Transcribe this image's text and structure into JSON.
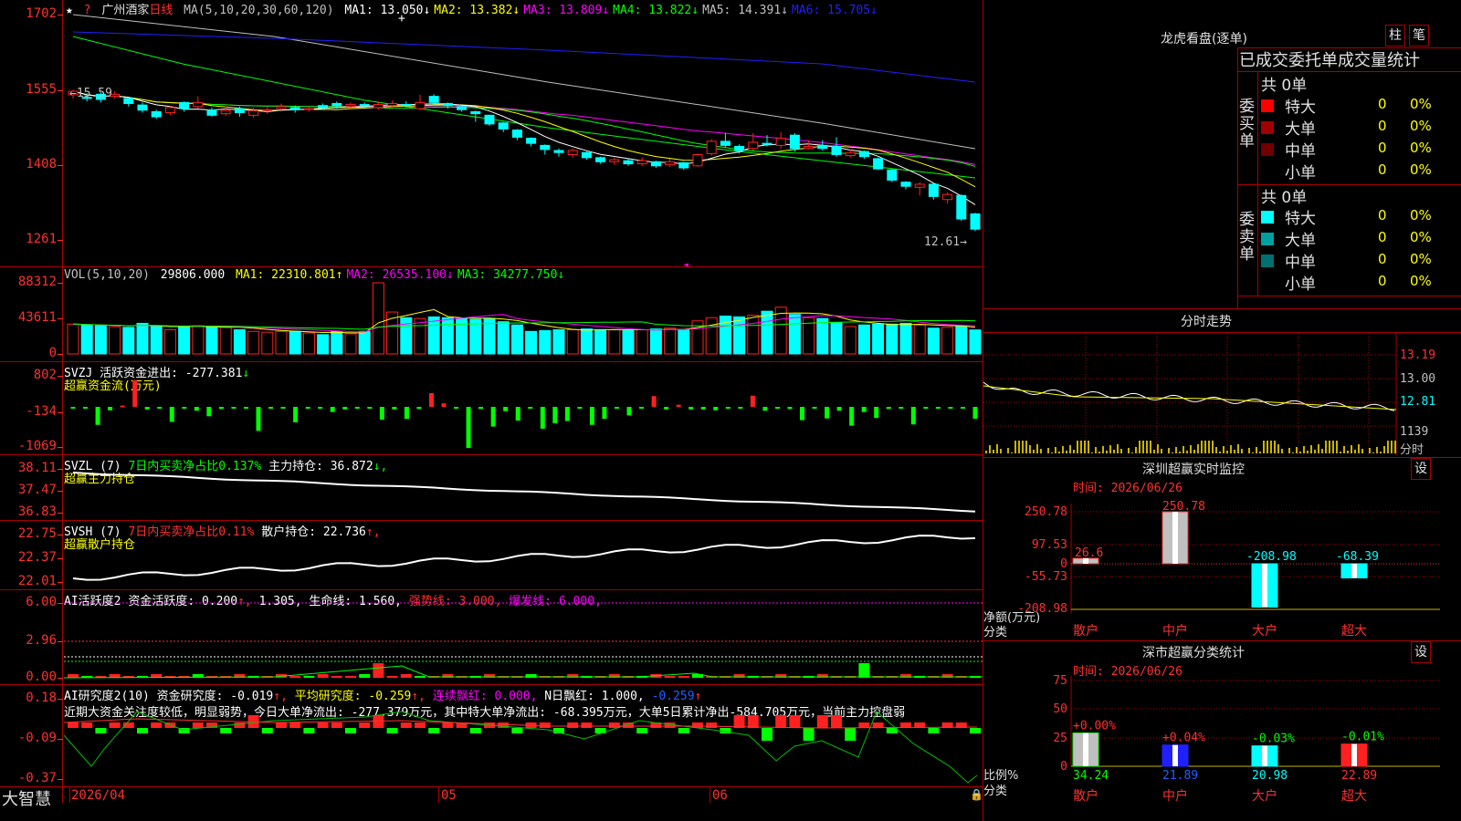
{
  "app": {
    "name": "大智慧"
  },
  "stock": {
    "name": "广州酒家",
    "period": "日线"
  },
  "colors": {
    "up": "#ff2020",
    "down": "#00ffff",
    "grid": "#a80000",
    "ma1": "#ffff00",
    "ma2": "#ff00ff",
    "ma3": "#00ff00",
    "ma4": "#ffffff",
    "ma5": "#c0c0c0",
    "ma6": "#2020ff"
  },
  "main_chart": {
    "ma_header": "MA(5,10,20,30,60,120)",
    "ma": [
      {
        "label": "MA1: 13.050",
        "arrow": "↓",
        "color": "#ffffff"
      },
      {
        "label": "MA2: 13.382",
        "arrow": "↓",
        "color": "#ffff00"
      },
      {
        "label": "MA3: 13.809",
        "arrow": "↓",
        "color": "#ff00ff"
      },
      {
        "label": "MA4: 13.822",
        "arrow": "↓",
        "color": "#00ff00"
      },
      {
        "label": "MA5: 14.391",
        "arrow": "↓",
        "color": "#c0c0c0"
      },
      {
        "label": "MA6: 15.705",
        "arrow": "↓",
        "color": "#2020ff"
      }
    ],
    "y_ticks": [
      "1702",
      "1555",
      "1408",
      "1261"
    ],
    "high_label": "←15.59",
    "last_label": "12.61→"
  },
  "vol_panel": {
    "header": "VOL(5,10,20)",
    "value": "29806.000",
    "ma": [
      {
        "label": "MA1: 22310.801",
        "arrow": "↑",
        "color": "#ffff00"
      },
      {
        "label": "MA2: 26535.100",
        "arrow": "↓",
        "color": "#ff00ff"
      },
      {
        "label": "MA3: 34277.750",
        "arrow": "↓",
        "color": "#00ff00"
      }
    ],
    "y_ticks": [
      "88312",
      "43611",
      "0"
    ]
  },
  "svzj_panel": {
    "line1": "SVZJ  活跃资金进出: -277.381",
    "line1_arrow": "↓",
    "line2": "超赢资金流(万元)",
    "y_ticks": [
      "802",
      "-134",
      "-1069"
    ]
  },
  "svzl_panel": {
    "name": "SVZL (7)",
    "pct": "7日内买卖净占比0.137%",
    "hold": "主力持仓: 36.872",
    "arrow": "↓,",
    "line2": "超赢主力持仓",
    "y_ticks": [
      "38.11",
      "37.47",
      "36.83"
    ]
  },
  "svsh_panel": {
    "name": "SVSH (7)",
    "pct": "7日内买卖净占比0.11%",
    "hold": "散户持仓: 22.736",
    "arrow": "↑,",
    "line2": "超赢散户持仓",
    "y_ticks": [
      "22.75",
      "22.37",
      "22.01"
    ]
  },
  "ai_active_panel": {
    "name": "AI活跃度2",
    "a": "资金活跃度: 0.200",
    "b": "1.305,",
    "c": "生命线: 1.560,",
    "d": "强势线: 3.000,",
    "e": "爆发线: 6.000,",
    "y_ticks": [
      "6.00",
      "2.96",
      "0.00"
    ]
  },
  "ai_research_panel": {
    "name": "AI研究度2(10)",
    "a": "资金研究度: -0.019",
    "b": "平均研究度: -0.259",
    "c": "连续飘红: 0.000,",
    "d": "N日飘红: 1.000,",
    "e": "-0.259",
    "comment": "近期大资金关注度较低，明显弱势，今日大单净流出: -277.379万元，其中特大单净流出: -68.395万元，大单5日累计净出-584.705万元，当前主力控盘弱",
    "y_ticks": [
      "0.18",
      "-0.09",
      "-0.37"
    ]
  },
  "x_axis": {
    "labels": [
      "2026/04",
      "05",
      "06"
    ]
  },
  "lhb": {
    "title": "龙虎看盘(逐单)",
    "btn1": "柱",
    "btn2": "笔",
    "header": "已成交委托单成交量统计",
    "buy_label": "委买单",
    "sell_label": "委卖单",
    "buy_total": "共 0单",
    "sell_total": "共 0单",
    "buy_rows": [
      {
        "name": "特大",
        "count": "0",
        "pct": "0%",
        "color": "#ff0000"
      },
      {
        "name": "大单",
        "count": "0",
        "pct": "0%",
        "color": "#a00000"
      },
      {
        "name": "中单",
        "count": "0",
        "pct": "0%",
        "color": "#700000"
      },
      {
        "name": "小单",
        "count": "0",
        "pct": "0%",
        "color": "#000000"
      }
    ],
    "sell_rows": [
      {
        "name": "特大",
        "count": "0",
        "pct": "0%",
        "color": "#00ffff"
      },
      {
        "name": "大单",
        "count": "0",
        "pct": "0%",
        "color": "#00a0a0"
      },
      {
        "name": "中单",
        "count": "0",
        "pct": "0%",
        "color": "#007070"
      },
      {
        "name": "小单",
        "count": "0",
        "pct": "0%",
        "color": "#000000"
      }
    ]
  },
  "intraday": {
    "title": "分时走势",
    "prices": [
      "13.19",
      "13.00",
      "12.81"
    ],
    "volume": "1139",
    "vol_unit": "分时"
  },
  "monitor": {
    "title": "深圳超赢实时监控",
    "settings": "设",
    "time": "时间: 2026/06/26",
    "y_ticks": [
      "250.78",
      "97.53",
      "0",
      "-55.73",
      "-208.98"
    ],
    "y_label1": "净额(万元)",
    "y_label2": "分类",
    "categories": [
      "散户",
      "中户",
      "大户",
      "超大"
    ],
    "values": [
      26.6,
      250.78,
      -208.98,
      -68.39
    ],
    "value_labels": [
      "26.6",
      "250.78",
      "-208.98",
      "-68.39"
    ]
  },
  "classify": {
    "title": "深市超赢分类统计",
    "settings": "设",
    "time": "时间: 2026/06/26",
    "y_ticks": [
      "75",
      "50",
      "25",
      "0"
    ],
    "y_label1": "比例%",
    "y_label2": "分类",
    "categories": [
      "散户",
      "中户",
      "大户",
      "超大"
    ],
    "changes": [
      "+0.00%",
      "+0.04%",
      "-0.03%",
      "-0.01%"
    ],
    "values": [
      34.24,
      21.89,
      20.98,
      22.89
    ],
    "value_labels": [
      "34.24",
      "21.89",
      "20.98",
      "22.89"
    ]
  },
  "chart_data": [
    {
      "type": "candlestick",
      "title": "广州酒家 日线",
      "note": "K-line values estimated from price axis (1261–1702 scale labels)",
      "ylim": [
        12.4,
        17.2
      ],
      "candles": [
        [
          15.45,
          15.52,
          15.55,
          15.38
        ],
        [
          15.4,
          15.38,
          15.48,
          15.32
        ],
        [
          15.46,
          15.36,
          15.5,
          15.3
        ],
        [
          15.42,
          15.46,
          15.52,
          15.38
        ],
        [
          15.38,
          15.28,
          15.4,
          15.22
        ],
        [
          15.25,
          15.15,
          15.3,
          15.1
        ],
        [
          15.12,
          15.02,
          15.16,
          14.98
        ],
        [
          15.1,
          15.2,
          15.24,
          15.05
        ],
        [
          15.3,
          15.18,
          15.32,
          15.12
        ],
        [
          15.22,
          15.3,
          15.42,
          15.18
        ],
        [
          15.15,
          15.05,
          15.2,
          15.02
        ],
        [
          15.08,
          15.14,
          15.22,
          15.04
        ],
        [
          15.18,
          15.1,
          15.22,
          15.02
        ],
        [
          15.05,
          15.14,
          15.2,
          15.0
        ],
        [
          15.14,
          15.16,
          15.22,
          15.08
        ],
        [
          15.18,
          15.22,
          15.28,
          15.12
        ],
        [
          15.2,
          15.16,
          15.24,
          15.1
        ],
        [
          15.16,
          15.18,
          15.22,
          15.12
        ],
        [
          15.24,
          15.2,
          15.28,
          15.16
        ],
        [
          15.28,
          15.24,
          15.32,
          15.18
        ],
        [
          15.22,
          15.26,
          15.3,
          15.18
        ],
        [
          15.26,
          15.24,
          15.3,
          15.2
        ],
        [
          15.2,
          15.26,
          15.32,
          15.16
        ],
        [
          15.24,
          15.28,
          15.34,
          15.2
        ],
        [
          15.26,
          15.24,
          15.32,
          15.2
        ],
        [
          15.18,
          15.3,
          15.45,
          15.14
        ],
        [
          15.42,
          15.3,
          15.46,
          15.26
        ],
        [
          15.28,
          15.24,
          15.3,
          15.18
        ],
        [
          15.22,
          15.16,
          15.24,
          15.12
        ],
        [
          15.12,
          15.08,
          15.14,
          14.92
        ],
        [
          15.05,
          14.88,
          15.06,
          14.84
        ],
        [
          14.9,
          14.78,
          14.92,
          14.72
        ],
        [
          14.76,
          14.62,
          14.78,
          14.56
        ],
        [
          14.6,
          14.5,
          14.62,
          14.44
        ],
        [
          14.46,
          14.38,
          14.48,
          14.28
        ],
        [
          14.36,
          14.32,
          14.4,
          14.24
        ],
        [
          14.28,
          14.36,
          14.4,
          14.22
        ],
        [
          14.32,
          14.22,
          14.34,
          14.18
        ],
        [
          14.22,
          14.14,
          14.24,
          14.1
        ],
        [
          14.14,
          14.18,
          14.22,
          14.08
        ],
        [
          14.16,
          14.1,
          14.2,
          14.06
        ],
        [
          14.1,
          14.16,
          14.22,
          14.06
        ],
        [
          14.14,
          14.06,
          14.16,
          14.02
        ],
        [
          14.08,
          14.14,
          14.2,
          14.04
        ],
        [
          14.12,
          14.02,
          14.14,
          13.98
        ],
        [
          14.06,
          14.28,
          14.3,
          14.04
        ],
        [
          14.3,
          14.54,
          14.58,
          14.26
        ],
        [
          14.54,
          14.46,
          14.7,
          14.42
        ],
        [
          14.44,
          14.36,
          14.48,
          14.3
        ],
        [
          14.4,
          14.52,
          14.7,
          14.36
        ],
        [
          14.5,
          14.48,
          14.66,
          14.44
        ],
        [
          14.46,
          14.6,
          14.72,
          14.4
        ],
        [
          14.66,
          14.4,
          14.7,
          14.34
        ],
        [
          14.4,
          14.44,
          14.56,
          14.38
        ],
        [
          14.46,
          14.4,
          14.56,
          14.36
        ],
        [
          14.44,
          14.28,
          14.62,
          14.24
        ],
        [
          14.26,
          14.32,
          14.38,
          14.22
        ],
        [
          14.34,
          14.24,
          14.36,
          14.2
        ],
        [
          14.2,
          14.0,
          14.22,
          13.98
        ],
        [
          13.98,
          13.78,
          14.0,
          13.74
        ],
        [
          13.74,
          13.66,
          13.76,
          13.6
        ],
        [
          13.64,
          13.7,
          13.74,
          13.48
        ],
        [
          13.7,
          13.46,
          13.72,
          13.4
        ],
        [
          13.4,
          13.5,
          13.54,
          13.32
        ],
        [
          13.48,
          13.02,
          13.5,
          12.98
        ],
        [
          13.12,
          12.82,
          13.14,
          12.78
        ]
      ]
    },
    {
      "type": "bar",
      "title": "VOL(5,10,20)",
      "ylim": [
        0,
        88312
      ],
      "values": [
        37000,
        36000,
        35000,
        34000,
        33000,
        38000,
        35000,
        30000,
        34000,
        35000,
        34000,
        33000,
        30000,
        28000,
        27000,
        28000,
        28000,
        26000,
        24000,
        28000,
        25000,
        28000,
        88312,
        52000,
        45000,
        44000,
        46000,
        45000,
        44000,
        43000,
        44000,
        40000,
        36000,
        28000,
        29000,
        30000,
        30000,
        31000,
        30000,
        30000,
        29000,
        30000,
        31000,
        32000,
        30000,
        41000,
        45000,
        47000,
        46000,
        48000,
        53000,
        58000,
        49000,
        45000,
        44000,
        39000,
        34000,
        36000,
        37000,
        37000,
        38000,
        36000,
        32000,
        33000,
        35000,
        29806
      ]
    },
    {
      "type": "bar",
      "title": "SVZJ 活跃资金进出",
      "ylim": [
        -1069,
        802
      ],
      "values": [
        -10,
        -2,
        -420,
        -80,
        30,
        620,
        -60,
        -20,
        -350,
        -40,
        -90,
        -220,
        -50,
        -30,
        -20,
        -560,
        -40,
        -20,
        -360,
        -20,
        -20,
        -120,
        -60,
        -20,
        -20,
        -300,
        -60,
        -280,
        -50,
        320,
        80,
        -10,
        -960,
        -50,
        -460,
        -100,
        -320,
        -20,
        -510,
        -380,
        -330,
        -20,
        -420,
        -280,
        -20,
        -200,
        -30,
        250,
        -60,
        50,
        -60,
        -60,
        -80,
        -10,
        -20,
        260,
        -90,
        -30,
        -50,
        -310,
        -20,
        -270,
        -90,
        -440,
        -120,
        -260,
        -50,
        -20,
        -410,
        -40,
        -40,
        -20,
        -30,
        -277
      ]
    }
  ]
}
